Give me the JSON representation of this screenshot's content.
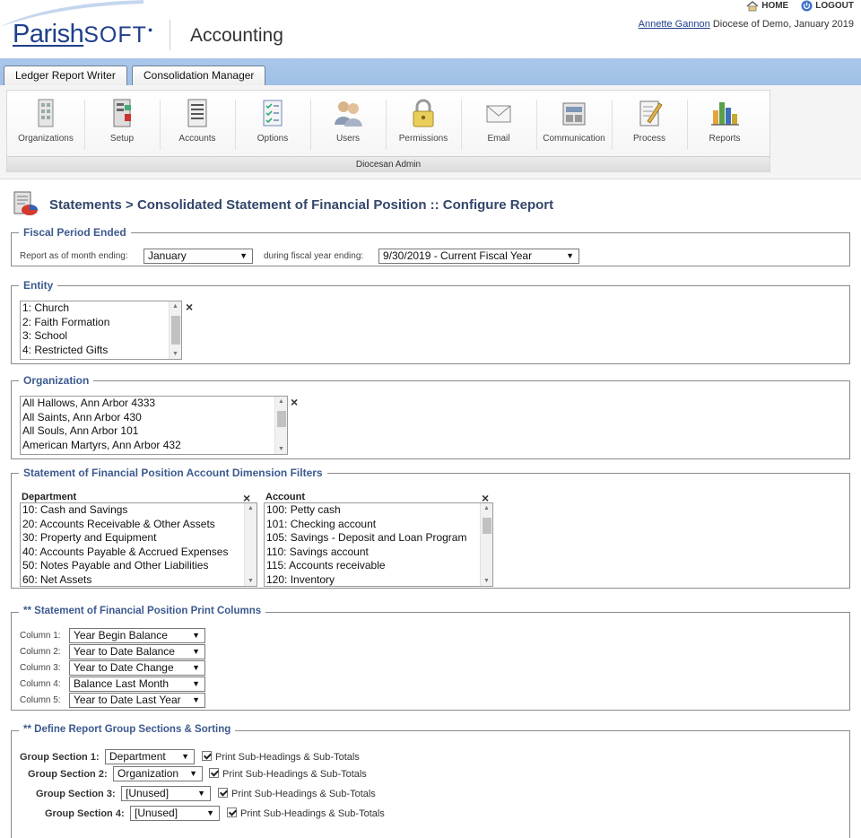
{
  "header": {
    "logo_part1": "Parish",
    "logo_part2": "SOFT",
    "app_title": "Accounting",
    "home_label": "HOME",
    "logout_label": "LOGOUT",
    "user_name": "Annette Gannon",
    "user_context": "Diocese of Demo, January 2019"
  },
  "tabs": [
    {
      "label": "Ledger Report Writer"
    },
    {
      "label": "Consolidation Manager"
    }
  ],
  "toolbar": {
    "items": [
      {
        "label": "Organizations",
        "icon": "organizations-icon"
      },
      {
        "label": "Setup",
        "icon": "setup-icon"
      },
      {
        "label": "Accounts",
        "icon": "accounts-icon"
      },
      {
        "label": "Options",
        "icon": "options-icon"
      },
      {
        "label": "Users",
        "icon": "users-icon"
      },
      {
        "label": "Permissions",
        "icon": "lock-icon"
      },
      {
        "label": "Email",
        "icon": "envelope-icon"
      },
      {
        "label": "Communication",
        "icon": "communication-icon"
      },
      {
        "label": "Process",
        "icon": "process-icon"
      },
      {
        "label": "Reports",
        "icon": "bar-chart-icon"
      }
    ],
    "footer": "Diocesan Admin"
  },
  "page": {
    "title": "Statements > Consolidated Statement of Financial Position :: Configure Report"
  },
  "fiscal": {
    "legend": "Fiscal Period Ended",
    "month_label": "Report as of month ending:",
    "month_value": "January",
    "year_label": "during fiscal year ending:",
    "year_value": "9/30/2019 - Current Fiscal Year"
  },
  "entity": {
    "legend": "Entity",
    "options": [
      "1: Church",
      "2: Faith Formation",
      "3: School",
      "4: Restricted Gifts"
    ]
  },
  "organization": {
    "legend": "Organization",
    "options": [
      "All Hallows, Ann Arbor 4333",
      "All Saints, Ann Arbor 430",
      "All Souls, Ann Arbor 101",
      "American Martyrs, Ann Arbor 432"
    ]
  },
  "filters": {
    "legend": "Statement of Financial Position Account Dimension Filters",
    "department_label": "Department",
    "department_options": [
      "10: Cash and Savings",
      "20: Accounts Receivable & Other Assets",
      "30: Property and Equipment",
      "40: Accounts Payable & Accrued Expenses",
      "50: Notes Payable and Other Liabilities",
      "60: Net Assets"
    ],
    "account_label": "Account",
    "account_options": [
      "100: Petty cash",
      "101: Checking account",
      "105: Savings - Deposit and Loan Program",
      "110: Savings account",
      "115: Accounts receivable",
      "120: Inventory"
    ]
  },
  "print_columns": {
    "legend": "** Statement of Financial Position Print Columns",
    "columns": [
      {
        "label": "Column 1:",
        "value": "Year Begin Balance"
      },
      {
        "label": "Column 2:",
        "value": "Year to Date Balance"
      },
      {
        "label": "Column 3:",
        "value": "Year to Date Change"
      },
      {
        "label": "Column 4:",
        "value": "Balance Last Month"
      },
      {
        "label": "Column 5:",
        "value": "Year to Date Last Year"
      }
    ]
  },
  "groups": {
    "legend": "** Define Report Group Sections & Sorting",
    "checkbox_label": "Print Sub-Headings & Sub-Totals",
    "sections": [
      {
        "label": "Group Section 1:",
        "value": "Department"
      },
      {
        "label": "Group Section 2:",
        "value": "Organization"
      },
      {
        "label": "Group Section 3:",
        "value": "[Unused]"
      },
      {
        "label": "Group Section 4:",
        "value": "[Unused]"
      }
    ]
  },
  "colors": {
    "brand": "#1f3f8c",
    "tabbar": "#a9c7ea",
    "legend": "#3c5a8f"
  }
}
